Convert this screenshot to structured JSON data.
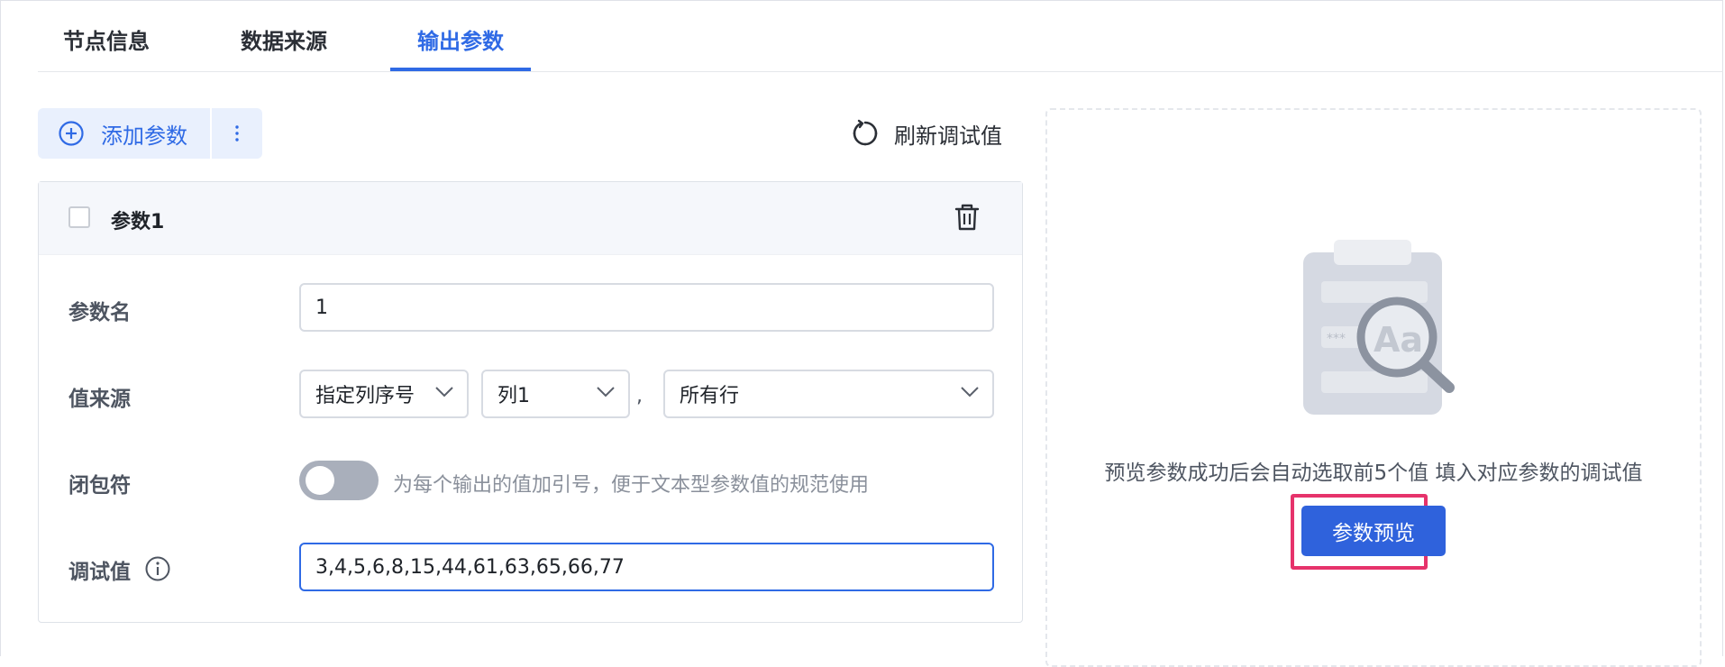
{
  "tabs": [
    {
      "label": "节点信息"
    },
    {
      "label": "数据来源"
    },
    {
      "label": "输出参数"
    }
  ],
  "toolbar": {
    "add_label": "添加参数",
    "refresh_label": "刷新调试值"
  },
  "param": {
    "title": "参数1",
    "name_label": "参数名",
    "name_value": "1",
    "source_label": "值来源",
    "source_type": "指定列序号",
    "source_column": "列1",
    "separator": ",",
    "source_rows": "所有行",
    "wrap_label": "闭包符",
    "wrap_hint": "为每个输出的值加引号，便于文本型参数值的规范使用",
    "wrap_enabled": false,
    "debug_label": "调试值",
    "debug_value": "3,4,5,6,8,15,44,61,63,65,66,77"
  },
  "preview": {
    "description": "预览参数成功后会自动选取前5个值 填入对应参数的调试值",
    "button_label": "参数预览"
  },
  "colors": {
    "accent": "#2f6ae5",
    "highlight": "#e6336b"
  }
}
